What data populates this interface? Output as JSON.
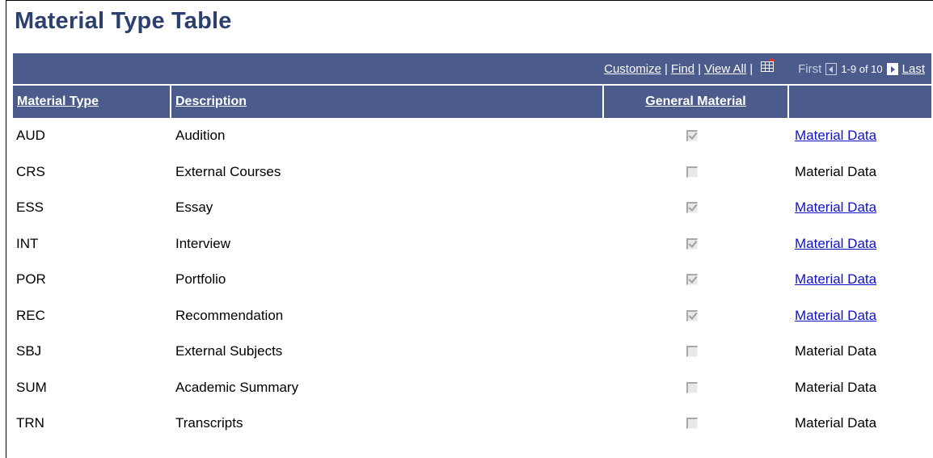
{
  "page": {
    "title": "Material Type Table"
  },
  "toolbar": {
    "customize": "Customize",
    "find": "Find",
    "view_all": "View All",
    "sep": "|",
    "first": "First",
    "count": "1-9 of 10",
    "last": "Last"
  },
  "columns": {
    "material_type": "Material Type",
    "description": "Description",
    "general_material": "General Material"
  },
  "rows": [
    {
      "type": "AUD",
      "description": "Audition",
      "general": true,
      "link_label": "Material Data",
      "link_active": true
    },
    {
      "type": "CRS",
      "description": "External Courses",
      "general": false,
      "link_label": "Material Data",
      "link_active": false
    },
    {
      "type": "ESS",
      "description": "Essay",
      "general": true,
      "link_label": "Material Data",
      "link_active": true
    },
    {
      "type": "INT",
      "description": "Interview",
      "general": true,
      "link_label": "Material Data",
      "link_active": true
    },
    {
      "type": "POR",
      "description": "Portfolio",
      "general": true,
      "link_label": "Material Data",
      "link_active": true
    },
    {
      "type": "REC",
      "description": "Recommendation",
      "general": true,
      "link_label": "Material Data",
      "link_active": true
    },
    {
      "type": "SBJ",
      "description": "External Subjects",
      "general": false,
      "link_label": "Material Data",
      "link_active": false
    },
    {
      "type": "SUM",
      "description": "Academic Summary",
      "general": false,
      "link_label": "Material Data",
      "link_active": false
    },
    {
      "type": "TRN",
      "description": "Transcripts",
      "general": false,
      "link_label": "Material Data",
      "link_active": false
    }
  ],
  "colors": {
    "header_bg": "#4a5b8c",
    "title": "#2c4070",
    "link": "#1010c8"
  }
}
